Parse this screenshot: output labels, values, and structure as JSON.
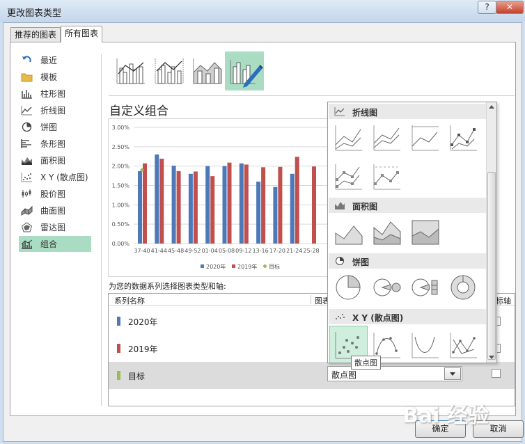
{
  "window": {
    "title": "更改图表类型",
    "help": "?",
    "close": "✕"
  },
  "tabs": [
    {
      "label": "推荐的图表"
    },
    {
      "label": "所有图表"
    }
  ],
  "sidebar": {
    "items": [
      {
        "label": "最近",
        "icon": "recent-icon"
      },
      {
        "label": "模板",
        "icon": "folder-icon"
      },
      {
        "label": "柱形图",
        "icon": "column-chart-icon"
      },
      {
        "label": "折线图",
        "icon": "line-chart-icon"
      },
      {
        "label": "饼图",
        "icon": "pie-chart-icon"
      },
      {
        "label": "条形图",
        "icon": "bar-chart-icon"
      },
      {
        "label": "面积图",
        "icon": "area-chart-icon"
      },
      {
        "label": "X Y (散点图)",
        "icon": "scatter-chart-icon"
      },
      {
        "label": "股价图",
        "icon": "stock-chart-icon"
      },
      {
        "label": "曲面图",
        "icon": "surface-chart-icon"
      },
      {
        "label": "雷达图",
        "icon": "radar-chart-icon"
      },
      {
        "label": "组合",
        "icon": "combo-chart-icon"
      }
    ]
  },
  "section": {
    "title": "自定义组合",
    "assign_label": "为您的数据系列选择图表类型和轴:"
  },
  "table": {
    "col_series": "系列名称",
    "col_type": "图表",
    "col_axis": "标轴",
    "rows": [
      {
        "name": "2020年",
        "color": "#4e79b8"
      },
      {
        "name": "2019年",
        "color": "#c0504d"
      },
      {
        "name": "目标",
        "color": "#9bbb59"
      }
    ]
  },
  "combo": {
    "value": "散点图"
  },
  "dropdown": {
    "groups": [
      {
        "label": "折线图"
      },
      {
        "label": "面积图"
      },
      {
        "label": "饼图"
      },
      {
        "label": "X Y (散点图)"
      }
    ]
  },
  "tooltip": "散点图",
  "buttons": {
    "ok": "确定",
    "cancel": "取消"
  },
  "watermark": "Bai 经验",
  "chart_data": {
    "type": "bar",
    "categories": [
      "37-40",
      "41-44",
      "45-48",
      "49-52",
      "01-04",
      "05-08",
      "09-12",
      "13-16",
      "17-20",
      "21-24",
      "25-28"
    ],
    "series": [
      {
        "name": "2020年",
        "values": [
          1.87,
          2.3,
          2.01,
          1.8,
          2.0,
          2.0,
          2.07,
          1.6,
          1.46,
          1.8,
          null
        ]
      },
      {
        "name": "2019年",
        "values": [
          2.07,
          2.19,
          1.87,
          1.86,
          1.74,
          2.09,
          2.04,
          1.97,
          1.98,
          2.24,
          1.99
        ]
      },
      {
        "name": "目标",
        "values": [
          1.9,
          null,
          null,
          null,
          null,
          null,
          null,
          null,
          null,
          null,
          null
        ]
      }
    ],
    "yticks": [
      "0.00%",
      "0.50%",
      "1.00%",
      "1.50%",
      "2.00%",
      "2.50%",
      "3.00%"
    ],
    "ylim": [
      0,
      3
    ],
    "grid": true,
    "legend": "bottom"
  }
}
